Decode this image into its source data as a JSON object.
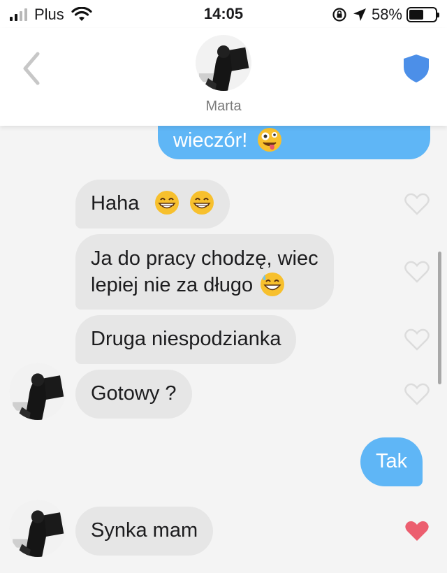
{
  "status_bar": {
    "carrier": "Plus",
    "time": "14:05",
    "battery_percent": "58%"
  },
  "header": {
    "contact_name": "Marta",
    "accent_color": "#4c8fe8"
  },
  "messages": [
    {
      "direction": "outgoing",
      "text": "wieczór!",
      "emoji": "zany-face"
    },
    {
      "direction": "incoming",
      "text": "Haha",
      "emoji": "grinning-face x2",
      "liked": false
    },
    {
      "direction": "incoming",
      "text_line1": "Ja do pracy chodzę, wiec",
      "text_line2": "lepiej nie za długo",
      "emoji": "grinning-face-with-sweat",
      "liked": false
    },
    {
      "direction": "incoming",
      "text": "Druga niespodzianka",
      "liked": false
    },
    {
      "direction": "incoming",
      "text": "Gotowy ?",
      "liked": false
    },
    {
      "direction": "outgoing",
      "text": "Tak"
    },
    {
      "direction": "incoming",
      "text": "Synka mam",
      "liked": true
    }
  ],
  "colors": {
    "incoming_bubble": "#e6e6e6",
    "outgoing_bubble": "#5fb6f6",
    "liked_heart": "#ec5e6f"
  }
}
